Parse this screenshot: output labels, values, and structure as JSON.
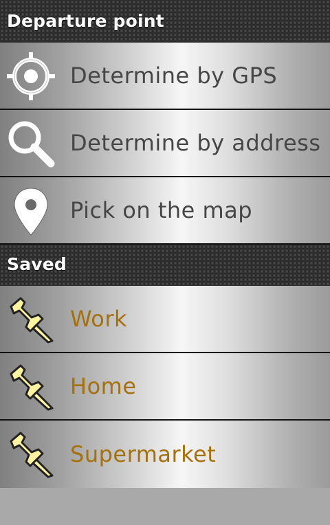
{
  "departure": {
    "header": "Departure point",
    "items": [
      {
        "label": "Determine by GPS",
        "icon": "gps-target-icon"
      },
      {
        "label": "Determine by address",
        "icon": "search-icon"
      },
      {
        "label": "Pick on the map",
        "icon": "map-pin-icon"
      }
    ]
  },
  "saved": {
    "header": "Saved",
    "items": [
      {
        "label": "Work",
        "icon": "pushpin-icon"
      },
      {
        "label": "Home",
        "icon": "pushpin-icon"
      },
      {
        "label": "Supermarket",
        "icon": "pushpin-icon"
      }
    ]
  },
  "colors": {
    "header_text": "#ffffff",
    "option_text": "#464646",
    "saved_text": "#a5710a",
    "pin_fill": "#fff4a0"
  }
}
